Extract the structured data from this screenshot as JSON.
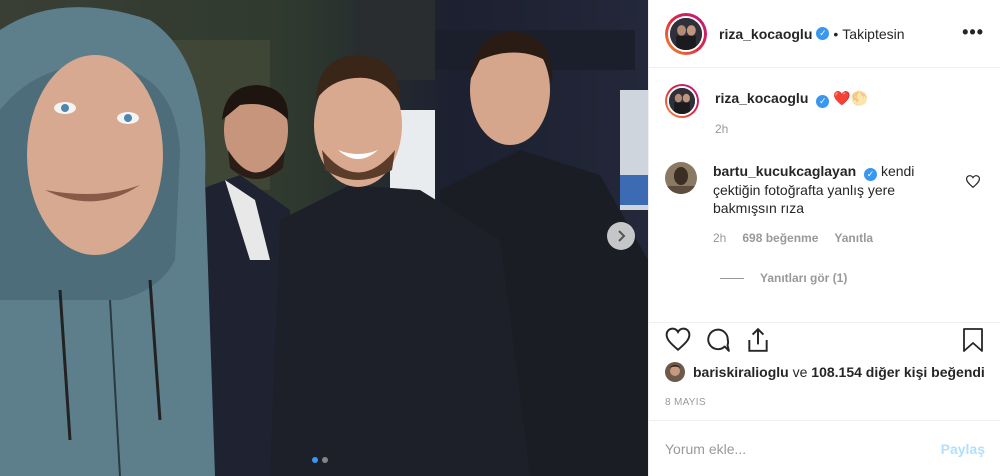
{
  "post": {
    "author": "riza_kocaoglu",
    "following_label": "Takiptesin",
    "separator": "•",
    "more_label": "•••",
    "carousel": {
      "total_images": 2,
      "current_index": 0
    }
  },
  "caption": {
    "author": "riza_kocaoglu",
    "emoji": "❤️🌕",
    "time": "2h"
  },
  "comment": {
    "author": "bartu_kucukcaglayan",
    "text": "kendi çektiğin fotoğrafta yanlış yere bakmışsın rıza",
    "time": "2h",
    "likes": "698 beğenme",
    "reply_label": "Yanıtla",
    "view_replies": "Yanıtları gör (1)"
  },
  "likes": {
    "user": "bariskiralioglu",
    "connector": " ve ",
    "others": "108.154 diğer kişi",
    "suffix": " beğendi"
  },
  "date": "8 MAYIS",
  "add_comment": {
    "placeholder": "Yorum ekle...",
    "post_label": "Paylaş"
  },
  "colors": {
    "verified": "#3897f0",
    "post_button_disabled": "#b2dffc",
    "carousel_dot_active": "#3897f0"
  },
  "icons": [
    "verified-icon",
    "more-icon",
    "chevron-right-icon",
    "heart-icon",
    "comment-icon",
    "share-icon",
    "bookmark-icon"
  ]
}
